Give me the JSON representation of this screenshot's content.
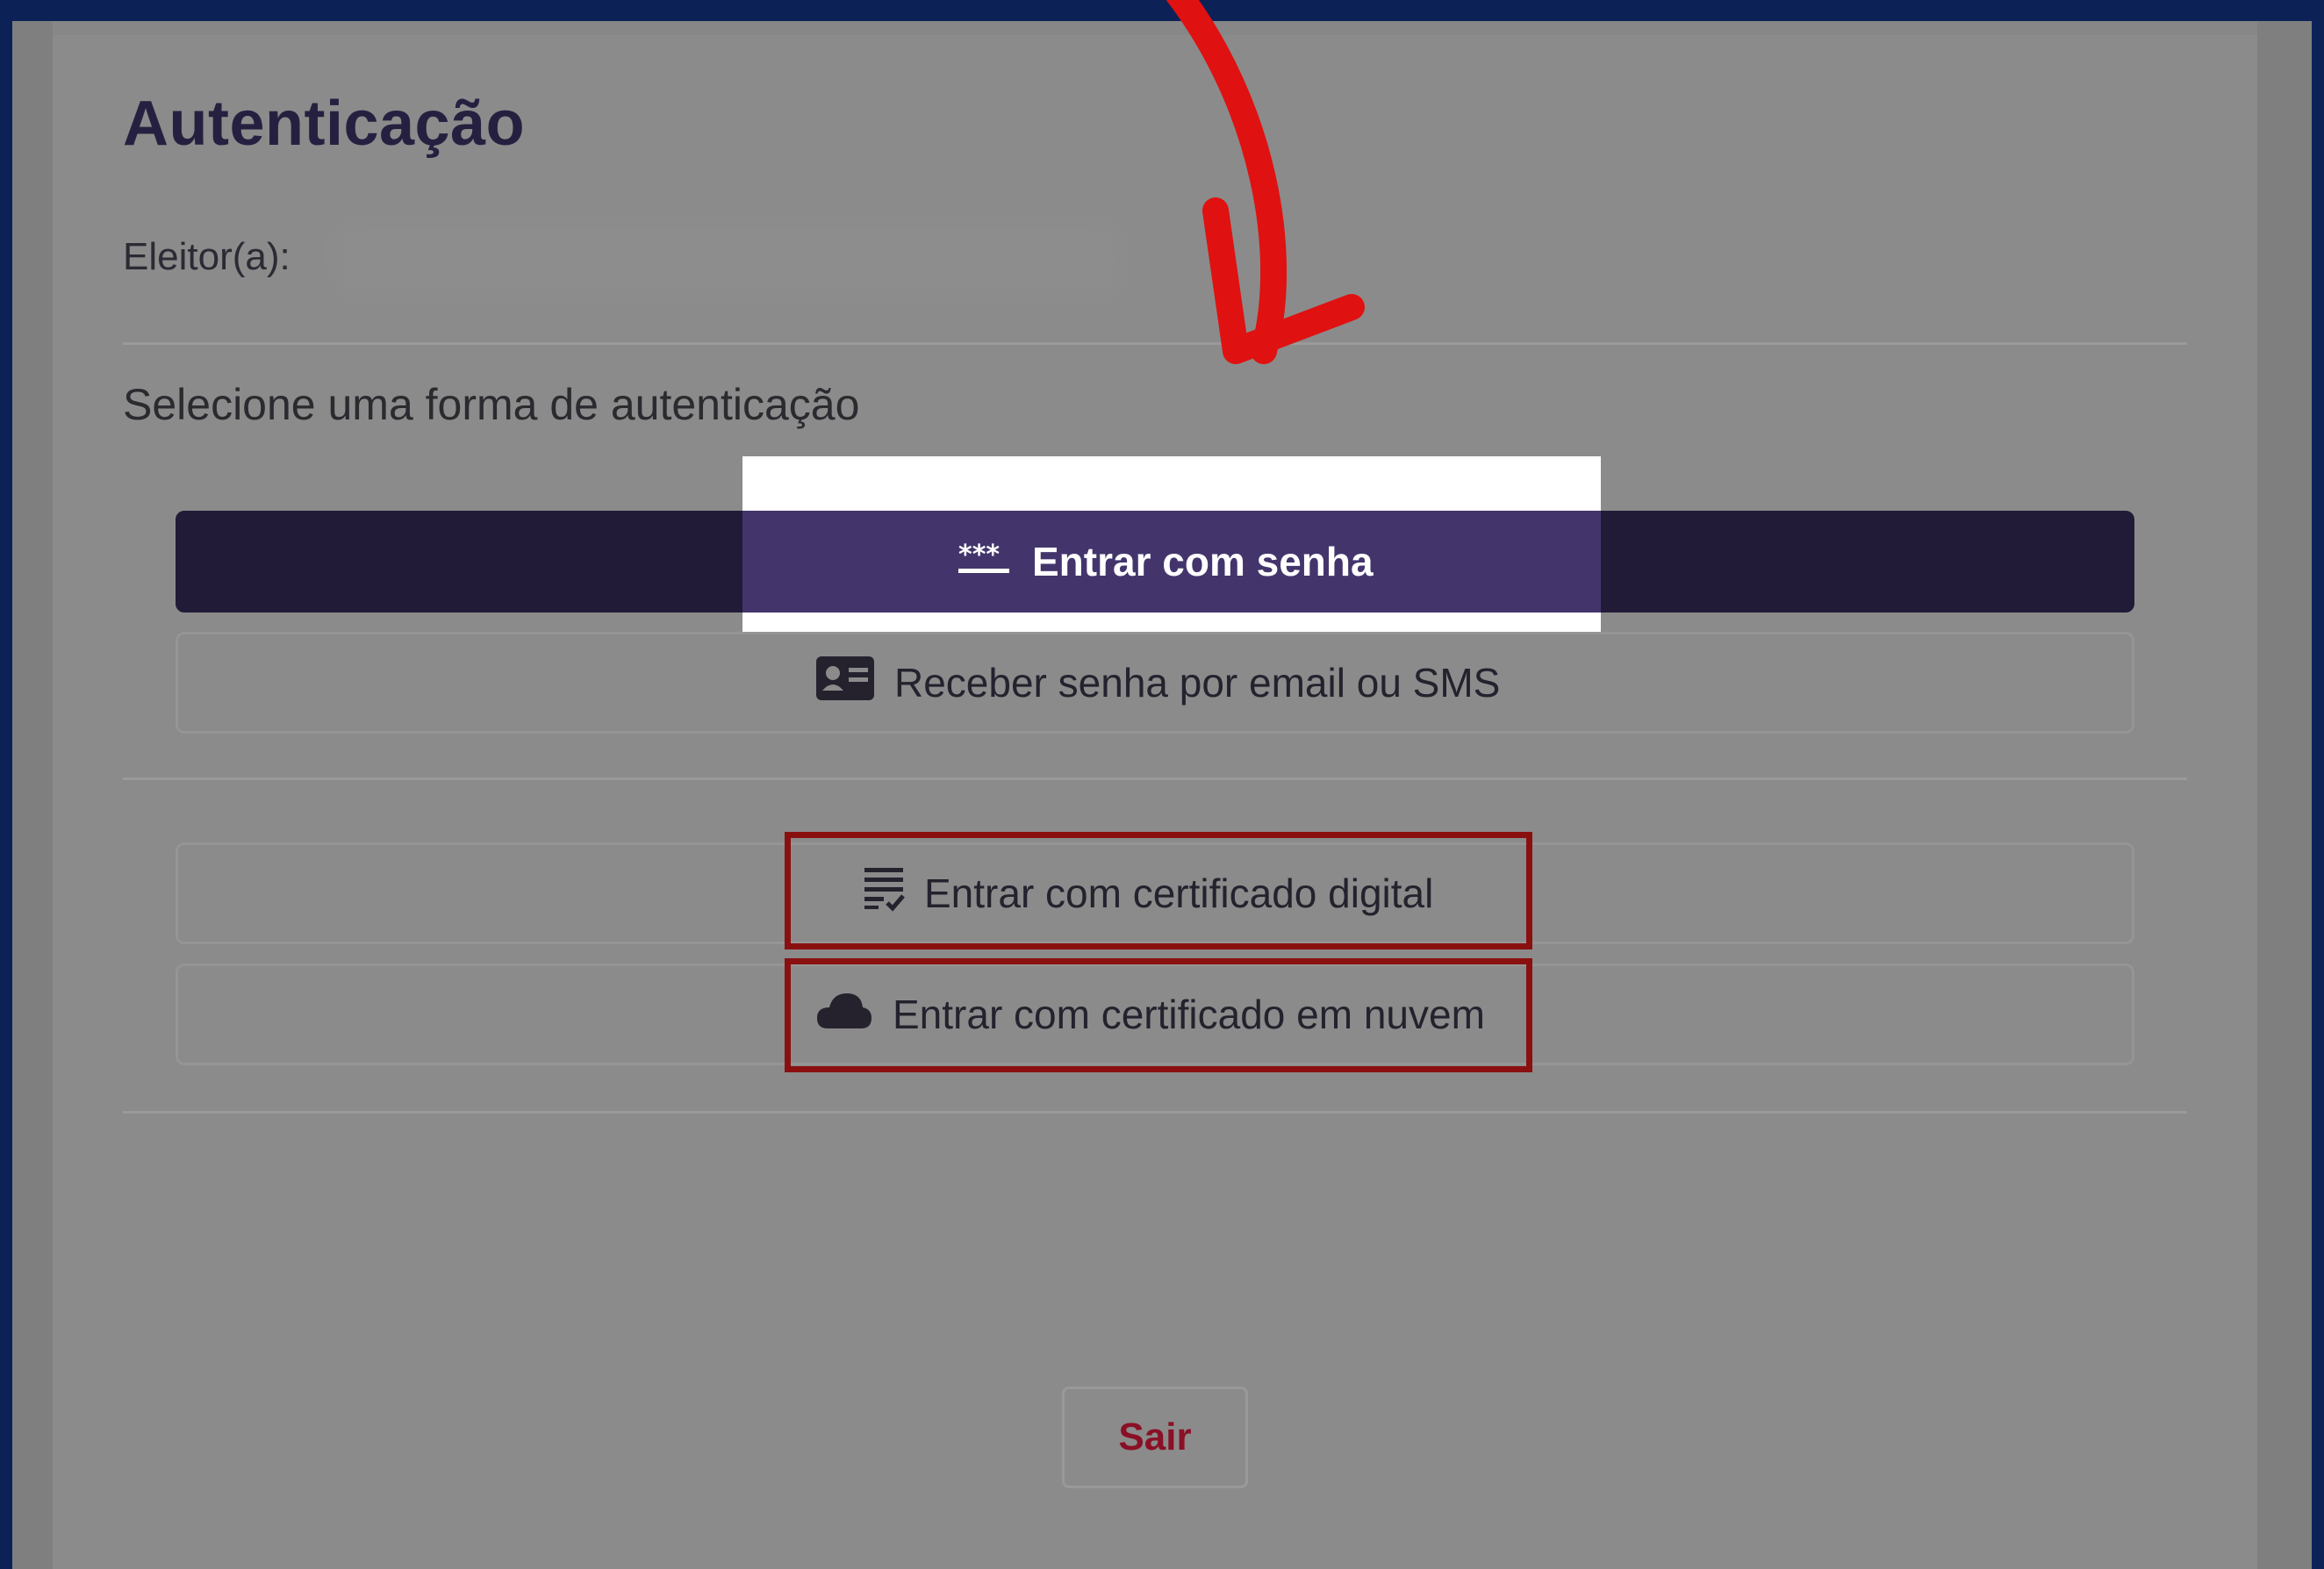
{
  "page": {
    "title": "Autenticação",
    "voter_label": "Eleitor(a):",
    "prompt": "Selecione uma forma de autenticação"
  },
  "options": {
    "password": {
      "label": "Entrar com senha",
      "icon": "password-dots-icon"
    },
    "sms": {
      "label": "Receber senha por email ou SMS",
      "icon": "id-card-icon"
    },
    "certificate": {
      "label": "Entrar com certificado digital",
      "icon": "certificate-list-icon"
    },
    "cloud": {
      "label": "Entrar com certificado em nuvem",
      "icon": "cloud-icon"
    }
  },
  "footer": {
    "exit_label": "Sair"
  },
  "colors": {
    "primary": "#211b38",
    "highlight": "#43356c",
    "annotation_red": "#e01111",
    "exit_text": "#8a1025",
    "page_background": "#0c2257"
  }
}
